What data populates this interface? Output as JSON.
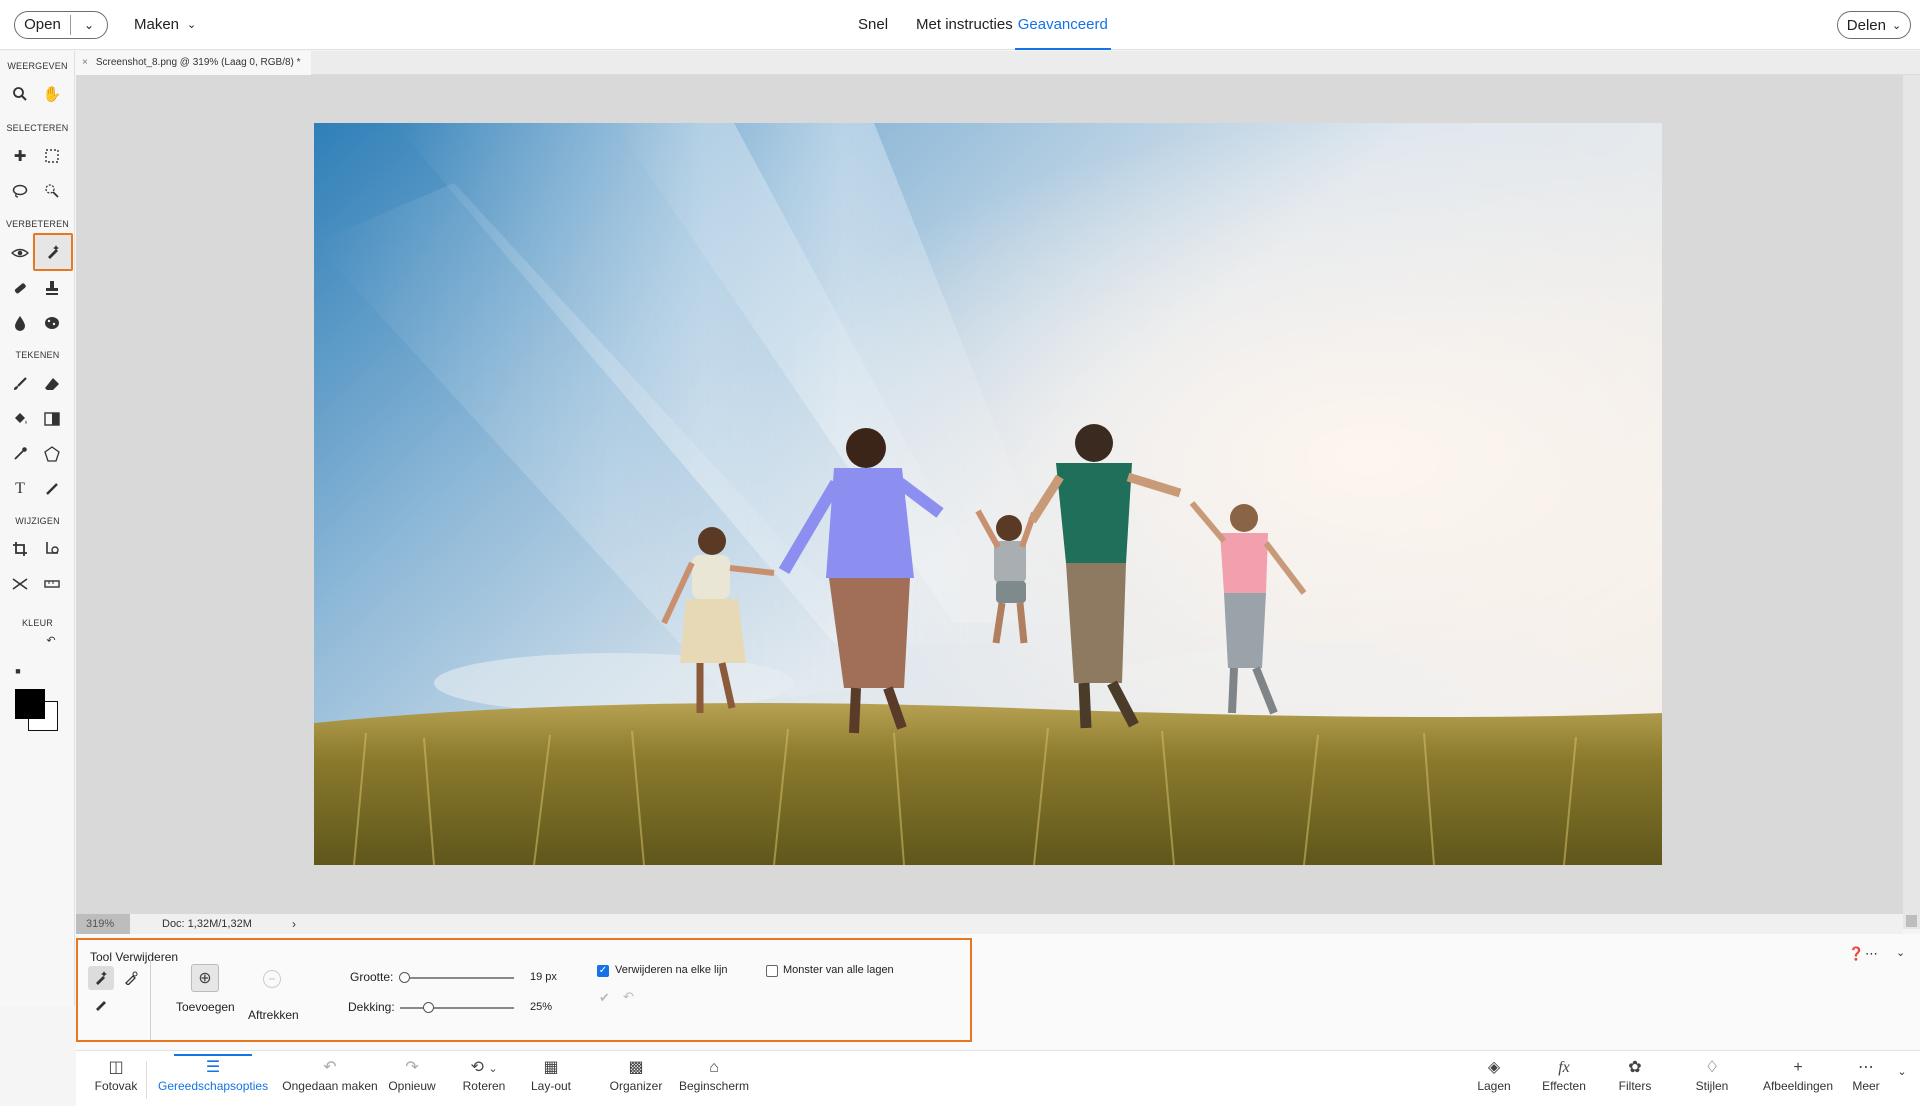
{
  "topbar": {
    "open_label": "Open",
    "maken_label": "Maken",
    "modes": [
      "Snel",
      "Met instructies",
      "Geavanceerd"
    ],
    "active_mode": "Geavanceerd",
    "share_label": "Delen"
  },
  "toolbar": {
    "sections": [
      "WEERGEVEN",
      "SELECTEREN",
      "VERBETEREN",
      "TEKENEN",
      "WIJZIGEN",
      "KLEUR"
    ],
    "selected_tool": "remove-tool",
    "foreground_color": "#000000",
    "background_color": "#ffffff"
  },
  "document": {
    "tab_title": "Screenshot_8.png @ 319% (Laag 0, RGB/8) *",
    "zoom": "319%",
    "doc_size": "Doc: 1,32M/1,32M"
  },
  "tool_options": {
    "title": "Tool Verwijderen",
    "add_label": "Toevoegen",
    "subtract_label": "Aftrekken",
    "size_label": "Grootte:",
    "size_value": "19 px",
    "size_fraction": 0.0,
    "opacity_label": "Dekking:",
    "opacity_value": "25%",
    "opacity_fraction": 0.25,
    "remove_each_stroke_label": "Verwijderen na elke lijn",
    "remove_each_stroke_checked": true,
    "sample_all_layers_label": "Monster van alle lagen",
    "sample_all_layers_checked": false
  },
  "bottombar": {
    "left_items": [
      "Fotovak",
      "Gereedschapsopties",
      "Ongedaan maken",
      "Opnieuw",
      "Roteren",
      "Lay-out",
      "Organizer",
      "Beginscherm"
    ],
    "active_item": "Gereedschapsopties",
    "right_items": [
      "Lagen",
      "Effecten",
      "Filters",
      "Stijlen",
      "Afbeeldingen",
      "Meer"
    ]
  },
  "colors": {
    "accent": "#1473e6",
    "highlight": "#e87722"
  }
}
